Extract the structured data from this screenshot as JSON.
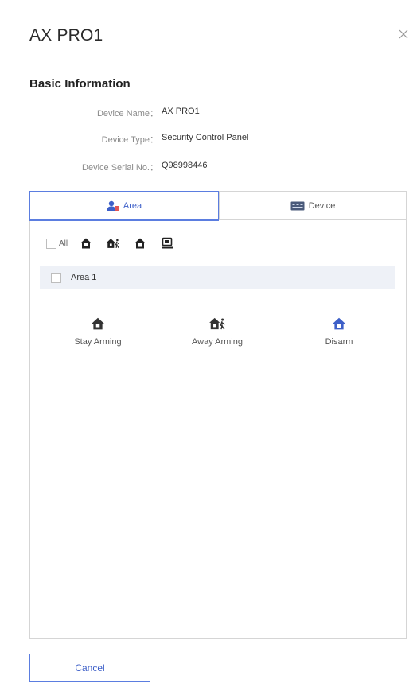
{
  "dialog": {
    "title": "AX PRO1"
  },
  "basic_info": {
    "heading": "Basic Information",
    "rows": [
      {
        "label": "Device Name：",
        "value": "AX PRO1"
      },
      {
        "label": "Device Type：",
        "value": "Security Control Panel"
      },
      {
        "label": "Device Serial No.：",
        "value": "Q98998446"
      }
    ]
  },
  "tabs": [
    {
      "label": "Area",
      "icon": "area-person-icon",
      "active": true
    },
    {
      "label": "Device",
      "icon": "device-panel-icon",
      "active": false
    }
  ],
  "toolbar": {
    "all_label": "All",
    "icons": [
      "stay-arm-icon",
      "away-arm-icon",
      "disarm-icon",
      "clear-alarm-icon"
    ]
  },
  "areas": [
    {
      "label": "Area 1"
    }
  ],
  "actions": [
    {
      "label": "Stay Arming",
      "icon": "stay-arm-icon",
      "color": "#333333"
    },
    {
      "label": "Away Arming",
      "icon": "away-arm-icon",
      "color": "#333333"
    },
    {
      "label": "Disarm",
      "icon": "disarm-icon",
      "color": "#3d5fc8"
    }
  ],
  "footer": {
    "cancel_label": "Cancel"
  },
  "colors": {
    "accent": "#3d5fc8",
    "border": "#d5d5d5",
    "area_row_bg": "#eef1f7"
  }
}
